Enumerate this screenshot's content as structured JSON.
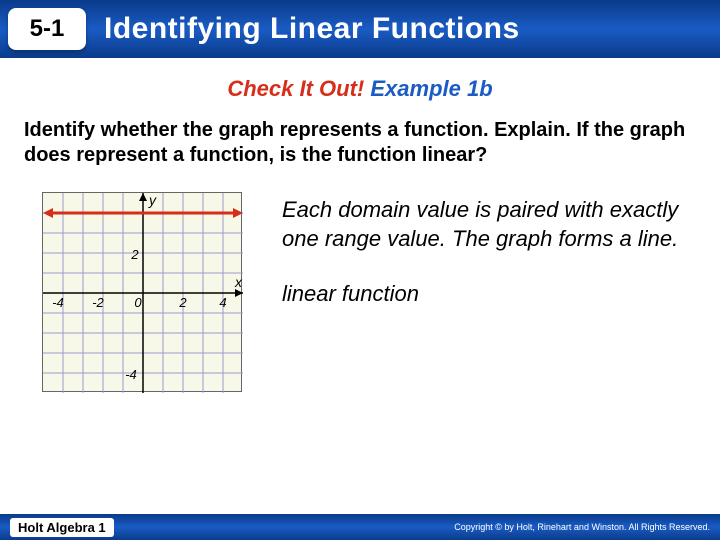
{
  "header": {
    "section_number": "5-1",
    "title": "Identifying Linear Functions"
  },
  "subtitle": {
    "check": "Check It Out!",
    "example": "Example 1b"
  },
  "question": "Identify whether the graph represents a function. Explain. If the graph does represent a function, is the function linear?",
  "answer": {
    "explanation": "Each domain value is paired with exactly one range value. The graph forms a line.",
    "conclusion": "linear function"
  },
  "footer": {
    "left": "Holt Algebra 1",
    "right": "Copyright © by Holt, Rinehart and Winston. All Rights Reserved."
  },
  "chart_data": {
    "type": "line",
    "title": "",
    "xlabel": "x",
    "ylabel": "y",
    "xlim": [
      -5,
      5
    ],
    "ylim": [
      -5,
      5
    ],
    "x_ticks": [
      -4,
      -2,
      0,
      2,
      4
    ],
    "y_ticks": [
      -4,
      -2,
      2,
      4
    ],
    "series": [
      {
        "name": "horizontal-line",
        "y_value": 4,
        "x_range": [
          -5,
          5
        ],
        "color": "#d62e1a"
      }
    ]
  }
}
